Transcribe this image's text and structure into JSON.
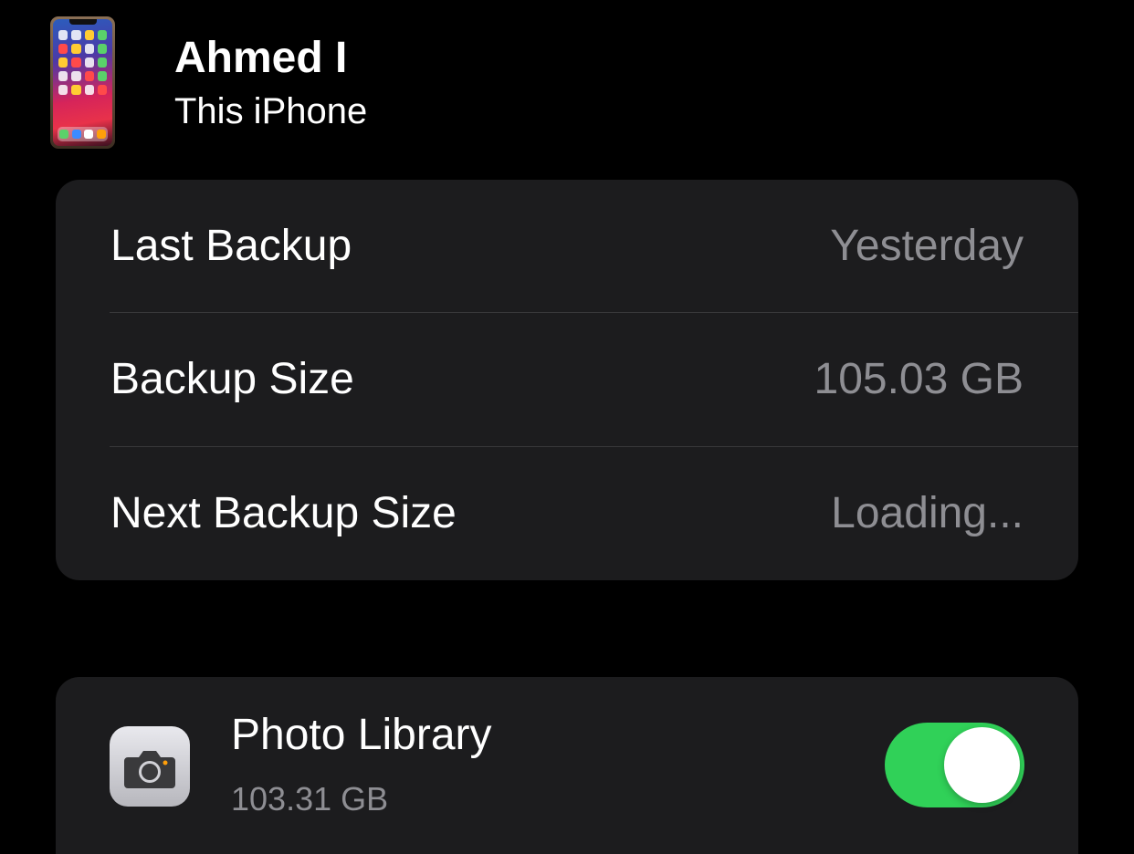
{
  "device": {
    "name": "Ahmed I",
    "subtitle": "This iPhone"
  },
  "backup_info": [
    {
      "label": "Last Backup",
      "value": "Yesterday"
    },
    {
      "label": "Backup Size",
      "value": "105.03 GB"
    },
    {
      "label": "Next Backup Size",
      "value": "Loading..."
    }
  ],
  "apps": [
    {
      "icon": "camera-icon",
      "name": "Photo Library",
      "size": "103.31 GB",
      "enabled": true
    }
  ],
  "colors": {
    "background": "#000000",
    "card": "#1c1c1e",
    "secondary_text": "#8e8e93",
    "toggle_on": "#30d158"
  }
}
